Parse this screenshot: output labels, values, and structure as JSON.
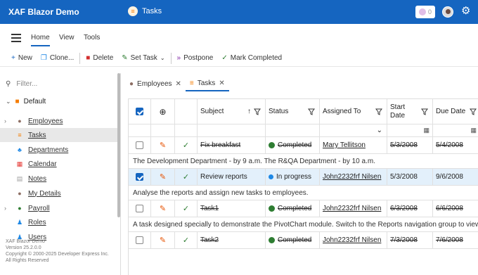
{
  "header": {
    "app_title": "XAF Blazor Demo",
    "page_title": "Tasks",
    "notification_count": "0"
  },
  "ribbon_tabs": [
    {
      "label": "Home",
      "active": true
    },
    {
      "label": "View"
    },
    {
      "label": "Tools"
    }
  ],
  "toolbar": {
    "new": "New",
    "clone": "Clone...",
    "delete": "Delete",
    "set_task": "Set Task",
    "postpone": "Postpone",
    "mark_completed": "Mark Completed"
  },
  "sidebar": {
    "filter_placeholder": "Filter...",
    "group": "Default",
    "items": [
      {
        "label": "Employees",
        "icon": "person-icon",
        "expandable": true
      },
      {
        "label": "Tasks",
        "icon": "tasks-icon",
        "selected": true
      },
      {
        "label": "Departments",
        "icon": "departments-icon"
      },
      {
        "label": "Calendar",
        "icon": "calendar-icon"
      },
      {
        "label": "Notes",
        "icon": "notes-icon"
      },
      {
        "label": "My Details",
        "icon": "my-details-icon"
      },
      {
        "label": "Payroll",
        "icon": "payroll-icon",
        "expandable": true
      },
      {
        "label": "Roles",
        "icon": "roles-icon"
      },
      {
        "label": "Users",
        "icon": "users-icon"
      }
    ],
    "footer": {
      "line1": "XAF Blazor Demo",
      "line2": "Version 25.2.0.0",
      "line3": "Copyright © 2000-2025 Developer Express Inc.",
      "line4": "All Rights Reserved"
    }
  },
  "doc_tabs": [
    {
      "label": "Employees"
    },
    {
      "label": "Tasks",
      "active": true
    }
  ],
  "grid": {
    "columns": {
      "subject": "Subject",
      "status": "Status",
      "assigned_to": "Assigned To",
      "start_date": "Start Date",
      "due_date": "Due Date"
    },
    "rows": [
      {
        "subject": "Fix breakfast",
        "status": "Completed",
        "assigned_to": "Mary Tellitson",
        "start_date": "5/3/2008",
        "due_date": "5/4/2008",
        "checked": false,
        "completed": true,
        "description": "The Development Department - by 9 a.m. The R&QA Department - by 10 a.m."
      },
      {
        "subject": "Review reports",
        "status": "In progress",
        "assigned_to": "John2232frf Nilsen",
        "start_date": "5/3/2008",
        "due_date": "9/6/2008",
        "checked": true,
        "completed": false,
        "description": "Analyse the reports and assign new tasks to employees."
      },
      {
        "subject": "Task1",
        "status": "Completed",
        "assigned_to": "John2232frf Nilsen",
        "start_date": "6/3/2008",
        "due_date": "6/6/2008",
        "checked": false,
        "completed": true,
        "description": "A task designed specially to demonstrate the PivotChart module. Switch to the Reports navigation group to view the gene"
      },
      {
        "subject": "Task2",
        "status": "Completed",
        "assigned_to": "John2232frf Nilsen",
        "start_date": "7/3/2008",
        "due_date": "7/6/2008",
        "checked": false,
        "completed": true,
        "description": ""
      }
    ]
  },
  "colors": {
    "header_bg": "#1565c0",
    "accent": "#1565c0",
    "completed_icon": "#2e7d32",
    "in_progress_icon": "#1e88e5",
    "edit_icon": "#e65100"
  }
}
